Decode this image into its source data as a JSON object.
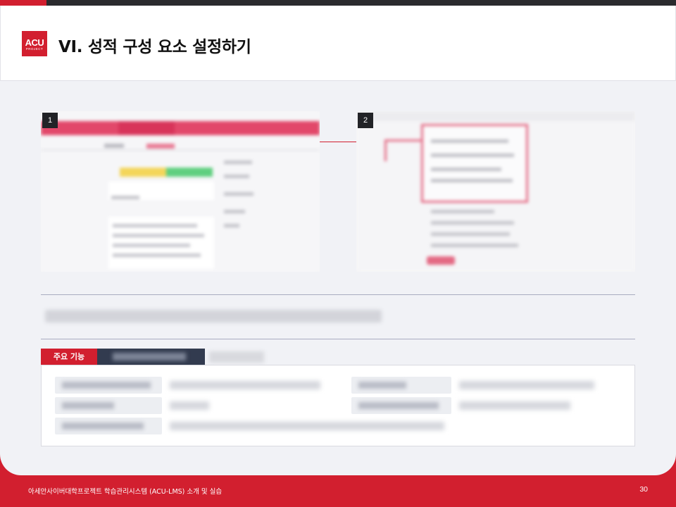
{
  "header": {
    "logo_text": "ACU",
    "logo_subtext": "PROJECT",
    "title": "VI. 성적 구성 요소 설정하기"
  },
  "screenshots": [
    {
      "badge": "1"
    },
    {
      "badge": "2"
    }
  ],
  "features": {
    "tab_label": "주요 기능"
  },
  "footer": {
    "text": "아세안사이버대학프로젝트 학습관리시스템 (ACU-LMS) 소개 및 실습",
    "page_number": "30"
  },
  "colors": {
    "accent": "#d21f2f",
    "dark_tab": "#323b4f",
    "background": "#f1f2f6"
  }
}
